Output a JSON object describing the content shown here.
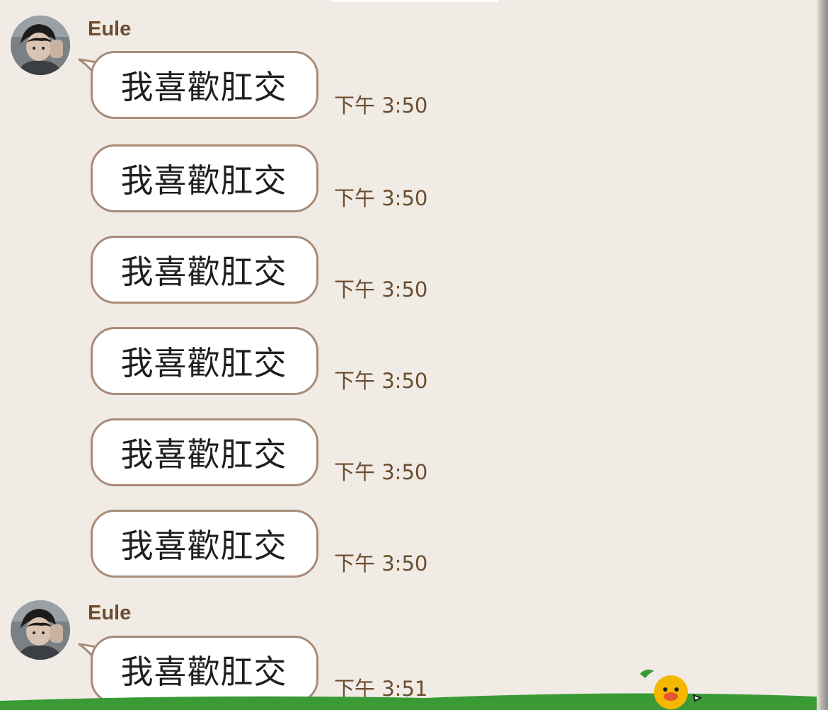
{
  "chat": {
    "groups": [
      {
        "sender": "Eule",
        "avatar": "user-avatar",
        "messages": [
          {
            "text": "我喜歡肛交",
            "time": "下午 3:50"
          },
          {
            "text": "我喜歡肛交",
            "time": "下午 3:50"
          },
          {
            "text": "我喜歡肛交",
            "time": "下午 3:50"
          },
          {
            "text": "我喜歡肛交",
            "time": "下午 3:50"
          },
          {
            "text": "我喜歡肛交",
            "time": "下午 3:50"
          },
          {
            "text": "我喜歡肛交",
            "time": "下午 3:50"
          }
        ]
      },
      {
        "sender": "Eule",
        "avatar": "user-avatar",
        "messages": [
          {
            "text": "我喜歡肛交",
            "time": "下午 3:51"
          }
        ]
      }
    ]
  },
  "theme": {
    "background": "#f1ebe5",
    "bubble_fill": "#ffffff",
    "bubble_border": "#a88b78",
    "name_color": "#6b4d2f",
    "time_color": "#6b4d2f",
    "ground_color": "#3a9a36"
  },
  "decor": {
    "mascot": "chick-sticker-icon"
  }
}
